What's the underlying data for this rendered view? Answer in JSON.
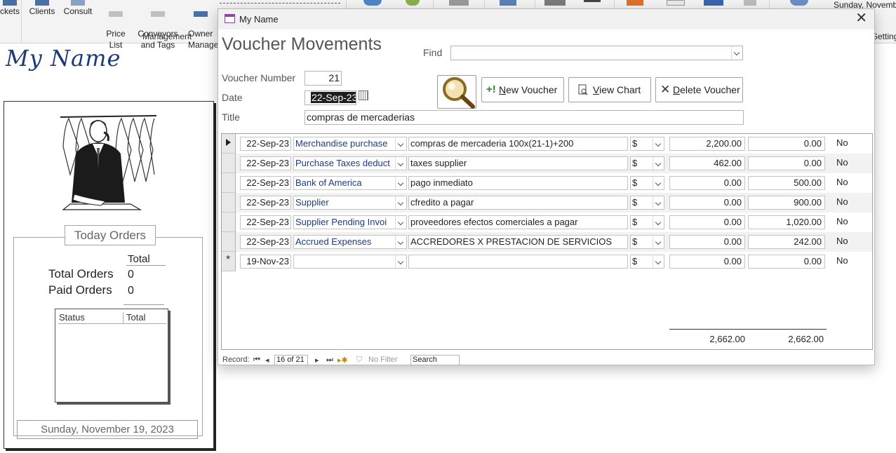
{
  "ribbon": {
    "buttons": [
      {
        "label": "ckets"
      },
      {
        "label": "Clients"
      },
      {
        "label": "Consult"
      },
      {
        "label": "Price\nList"
      },
      {
        "label": "Conveyors\nand Tags"
      },
      {
        "label": "Owner\nManage"
      }
    ],
    "group_label": "Management",
    "date_text": "Sunday, Novemb",
    "settings_text": "Setting"
  },
  "background": {
    "brand": "My Name",
    "today_orders_title": "Today Orders",
    "total_header": "Total",
    "total_orders_label": "Total Orders",
    "total_orders_value": "0",
    "paid_orders_label": "Paid Orders",
    "paid_orders_value": "0",
    "list_col_status": "Status",
    "list_col_total": "Total",
    "date": "Sunday, November 19, 2023"
  },
  "window": {
    "title": "My Name",
    "form_title": "Voucher Movements",
    "find_label": "Find",
    "find_value": "",
    "voucher_number_label": "Voucher Number",
    "voucher_number": "21",
    "date_label": "Date",
    "date_value": "22-Sep-23",
    "title_label": "Title",
    "title_value": "compras de mercaderias",
    "buttons": {
      "new_voucher_accel": "N",
      "new_voucher_rest": "ew Voucher",
      "view_chart_accel": "V",
      "view_chart_rest": "iew Chart",
      "delete_voucher_accel": "D",
      "delete_voucher_rest": "elete Voucher"
    }
  },
  "movements": [
    {
      "date": "22-Sep-23",
      "account": "Merchandise purchase",
      "description": "compras de mercaderia 100x(21-1)+200",
      "currency": "$",
      "debit": "2,200.00",
      "credit": "0.00",
      "flag": "No"
    },
    {
      "date": "22-Sep-23",
      "account": "Purchase Taxes deduct",
      "description": "taxes supplier",
      "currency": "$",
      "debit": "462.00",
      "credit": "0.00",
      "flag": "No"
    },
    {
      "date": "22-Sep-23",
      "account": "Bank of America",
      "description": "pago inmediato",
      "currency": "$",
      "debit": "0.00",
      "credit": "500.00",
      "flag": "No"
    },
    {
      "date": "22-Sep-23",
      "account": "Supplier",
      "description": "cfredito a pagar",
      "currency": "$",
      "debit": "0.00",
      "credit": "900.00",
      "flag": "No"
    },
    {
      "date": "22-Sep-23",
      "account": "Supplier Pending Invoi",
      "description": "proveedores efectos comerciales a pagar",
      "currency": "$",
      "debit": "0.00",
      "credit": "1,020.00",
      "flag": "No"
    },
    {
      "date": "22-Sep-23",
      "account": "Accrued Expenses",
      "description": "ACCREDORES X PRESTACION DE SERVICIOS",
      "currency": "$",
      "debit": "0.00",
      "credit": "242.00",
      "flag": "No"
    }
  ],
  "new_row": {
    "date": "19-Nov-23",
    "account": "",
    "description": "",
    "currency": "$",
    "debit": "0.00",
    "credit": "0.00",
    "flag": "No"
  },
  "totals": {
    "debit": "2,662.00",
    "credit": "2,662.00"
  },
  "navigator": {
    "record_label": "Record:",
    "position": "16 of 21",
    "filter_label": "No Filter",
    "search_label": "Search"
  }
}
